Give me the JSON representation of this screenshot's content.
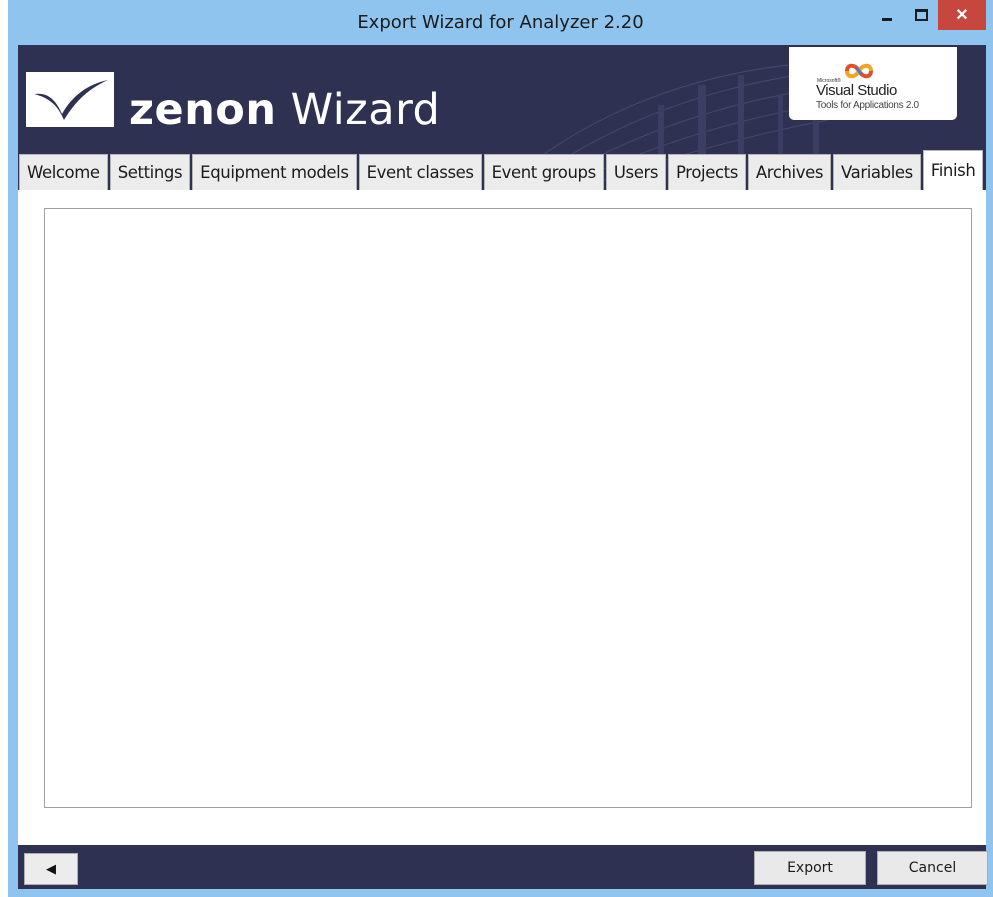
{
  "window": {
    "title": "Export Wizard for Analyzer 2.20",
    "controls": {
      "minimize": "minimize-icon",
      "maximize": "maximize-icon",
      "close": "✕"
    },
    "titlebar_color": "#8fc4ee",
    "close_color": "#c7463d"
  },
  "banner": {
    "brand_bold": "zenon",
    "brand_light": " Wizard",
    "background": "#2e3152",
    "badge": {
      "maker": "Microsoft®",
      "product": "Visual Studio",
      "subtitle": "Tools for Applications 2.0"
    }
  },
  "tabs": [
    {
      "label": "Welcome",
      "active": false
    },
    {
      "label": "Settings",
      "active": false
    },
    {
      "label": "Equipment models",
      "active": false
    },
    {
      "label": "Event classes",
      "active": false
    },
    {
      "label": "Event groups",
      "active": false
    },
    {
      "label": "Users",
      "active": false
    },
    {
      "label": "Projects",
      "active": false
    },
    {
      "label": "Archives",
      "active": false
    },
    {
      "label": "Variables",
      "active": false
    },
    {
      "label": "Finish",
      "active": true
    }
  ],
  "footer": {
    "back_glyph": "◀",
    "export_label": "Export",
    "cancel_label": "Cancel"
  }
}
